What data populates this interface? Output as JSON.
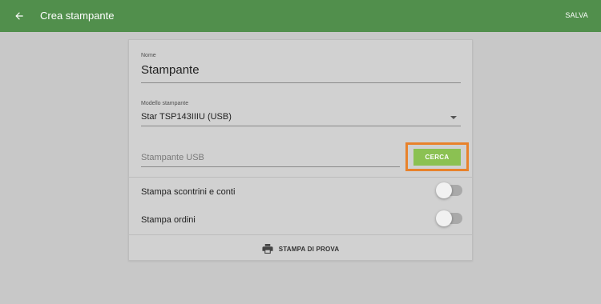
{
  "appbar": {
    "title": "Crea stampante",
    "save_label": "SALVA",
    "back_icon": "arrow-left-icon",
    "color": "#518f4c"
  },
  "form": {
    "name": {
      "label": "Nome",
      "value": "Stampante"
    },
    "model": {
      "label": "Modello stampante",
      "value": "Star TSP143IIIU (USB)",
      "dropdown_icon": "caret-down-icon"
    },
    "usb": {
      "placeholder": "Stampante USB",
      "search_label": "CERCA",
      "search_color": "#8bc152"
    },
    "toggles": [
      {
        "label": "Stampa scontrini e conti",
        "on": false
      },
      {
        "label": "Stampa ordini",
        "on": false
      }
    ],
    "test_print": {
      "label": "STAMPA DI PROVA",
      "icon": "printer-icon"
    }
  },
  "highlight_color": "#e8822b"
}
